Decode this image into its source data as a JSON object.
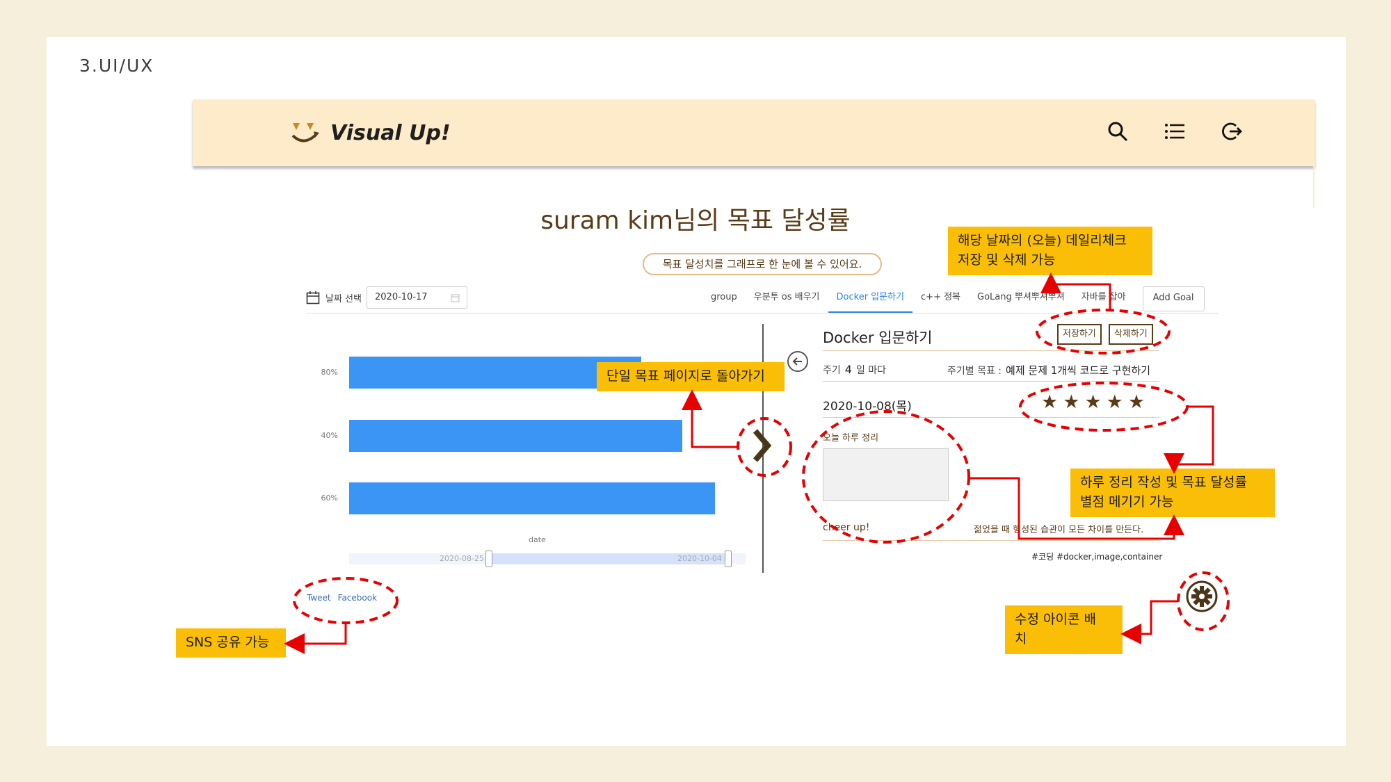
{
  "section": {
    "title": "3.UI/UX"
  },
  "header": {
    "logo_text": "Visual Up!",
    "icons": [
      "search-icon",
      "list-icon",
      "logout-icon"
    ]
  },
  "page": {
    "title": "suram kim님의 목표 달성률",
    "subtitle": "목표 달성치를 그래프로 한 눈에 볼 수 있어요."
  },
  "toolbar": {
    "date_label": "날짜 선택",
    "date_value": "2020-10-17",
    "tabs": [
      "group",
      "우분투 os 배우기",
      "Docker 입문하기",
      "c++ 정복",
      "GoLang 뿌셔뿌셔뿌셔",
      "자바를 잡아"
    ],
    "active_tab": "Docker 입문하기",
    "add_goal": "Add Goal"
  },
  "chart_data": {
    "type": "bar",
    "orientation": "horizontal",
    "categories": [
      "80%",
      "40%",
      "60%"
    ],
    "values": [
      0.72,
      0.82,
      0.9
    ],
    "xlabel": "date",
    "range_start": "2020-08-25",
    "range_end": "2020-10-04",
    "color": "#3a95f4"
  },
  "goal": {
    "title": "Docker 입문하기",
    "save_label": "저장하기",
    "delete_label": "삭제하기",
    "period_prefix": "주기",
    "period_value": "4",
    "period_suffix": "일 마다",
    "period_goal_label": "주기별 목표 :",
    "period_goal_value": "예제 문제 1개씩 코드로 구현하기",
    "date": "2020-10-08(목)",
    "rating": 5,
    "review_label": "오늘 하루 정리",
    "cheer": "cheer up!",
    "quote": "젊었을 때 형성된 습관이 모든 차이를 만든다.",
    "hashtags": "#코딩 #docker,image,container"
  },
  "sns": {
    "tweet": "Tweet",
    "facebook": "Facebook"
  },
  "annotations": {
    "daily_check": [
      "해당 날짜의 (오늘) 데일리체크",
      "저장 및 삭제 가능"
    ],
    "back_to_goal": "단일 목표 페이지로 돌아가기",
    "review_rating": [
      "하루 정리 작성 및 목표 달성률",
      "별점 메기기 가능"
    ],
    "edit_icon": [
      "수정 아이콘 배",
      "치"
    ],
    "sns_share": "SNS 공유 가능"
  },
  "colors": {
    "accent": "#fbbe07",
    "brand_brown": "#5a3b17",
    "header_bg": "#fdebc9",
    "annotation_red": "#e60000"
  }
}
